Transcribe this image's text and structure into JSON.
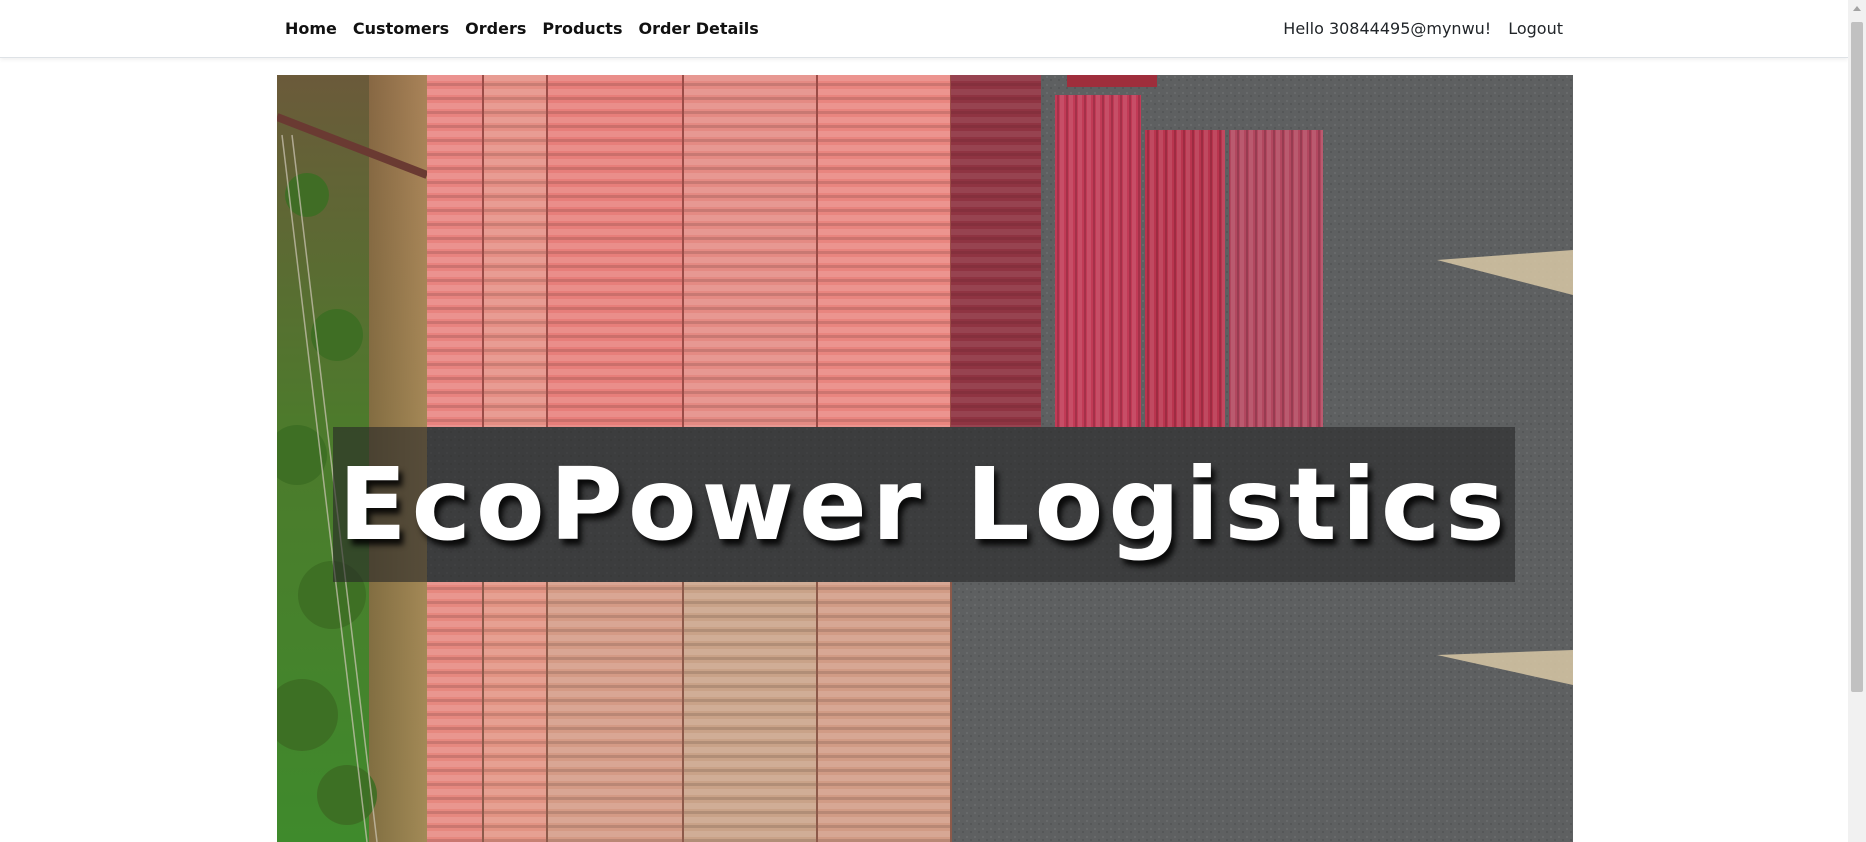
{
  "nav": {
    "links": [
      {
        "label": "Home"
      },
      {
        "label": "Customers"
      },
      {
        "label": "Orders"
      },
      {
        "label": "Products"
      },
      {
        "label": "Order Details"
      }
    ],
    "greeting": "Hello 30844495@mynwu!",
    "logout_label": "Logout"
  },
  "hero": {
    "title": "EcoPower Logistics",
    "image_description_icon": "shipping-containers-photo"
  },
  "colors": {
    "container_salmon": "#e27a78",
    "container_red": "#b8384f",
    "container_tan": "#c9937f",
    "ground_gray": "#5d5f60",
    "grass_green": "#4f7a2f"
  }
}
